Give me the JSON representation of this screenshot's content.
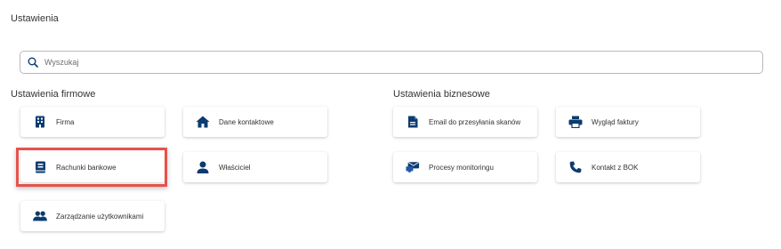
{
  "page": {
    "title": "Ustawienia"
  },
  "search": {
    "placeholder": "Wyszukaj"
  },
  "sections": {
    "company": {
      "title": "Ustawienia firmowe",
      "items": [
        {
          "label": "Firma",
          "icon": "building-icon"
        },
        {
          "label": "Dane kontaktowe",
          "icon": "home-icon"
        },
        {
          "label": "Rachunki bankowe",
          "icon": "book-icon",
          "highlighted": true
        },
        {
          "label": "Właściciel",
          "icon": "person-icon"
        },
        {
          "label": "Zarządzanie użytkownikami",
          "icon": "users-icon"
        }
      ]
    },
    "business": {
      "title": "Ustawienia biznesowe",
      "items": [
        {
          "label": "Email do przesyłania skanów",
          "icon": "document-icon"
        },
        {
          "label": "Wygląd faktury",
          "icon": "printer-icon"
        },
        {
          "label": "Procesy monitoringu",
          "icon": "mail-monitor-icon"
        },
        {
          "label": "Kontakt z BOK",
          "icon": "phone-icon"
        }
      ]
    }
  },
  "colors": {
    "icon": "#0b3b70",
    "highlight": "#e5534b",
    "border": "#b9b9b9"
  }
}
